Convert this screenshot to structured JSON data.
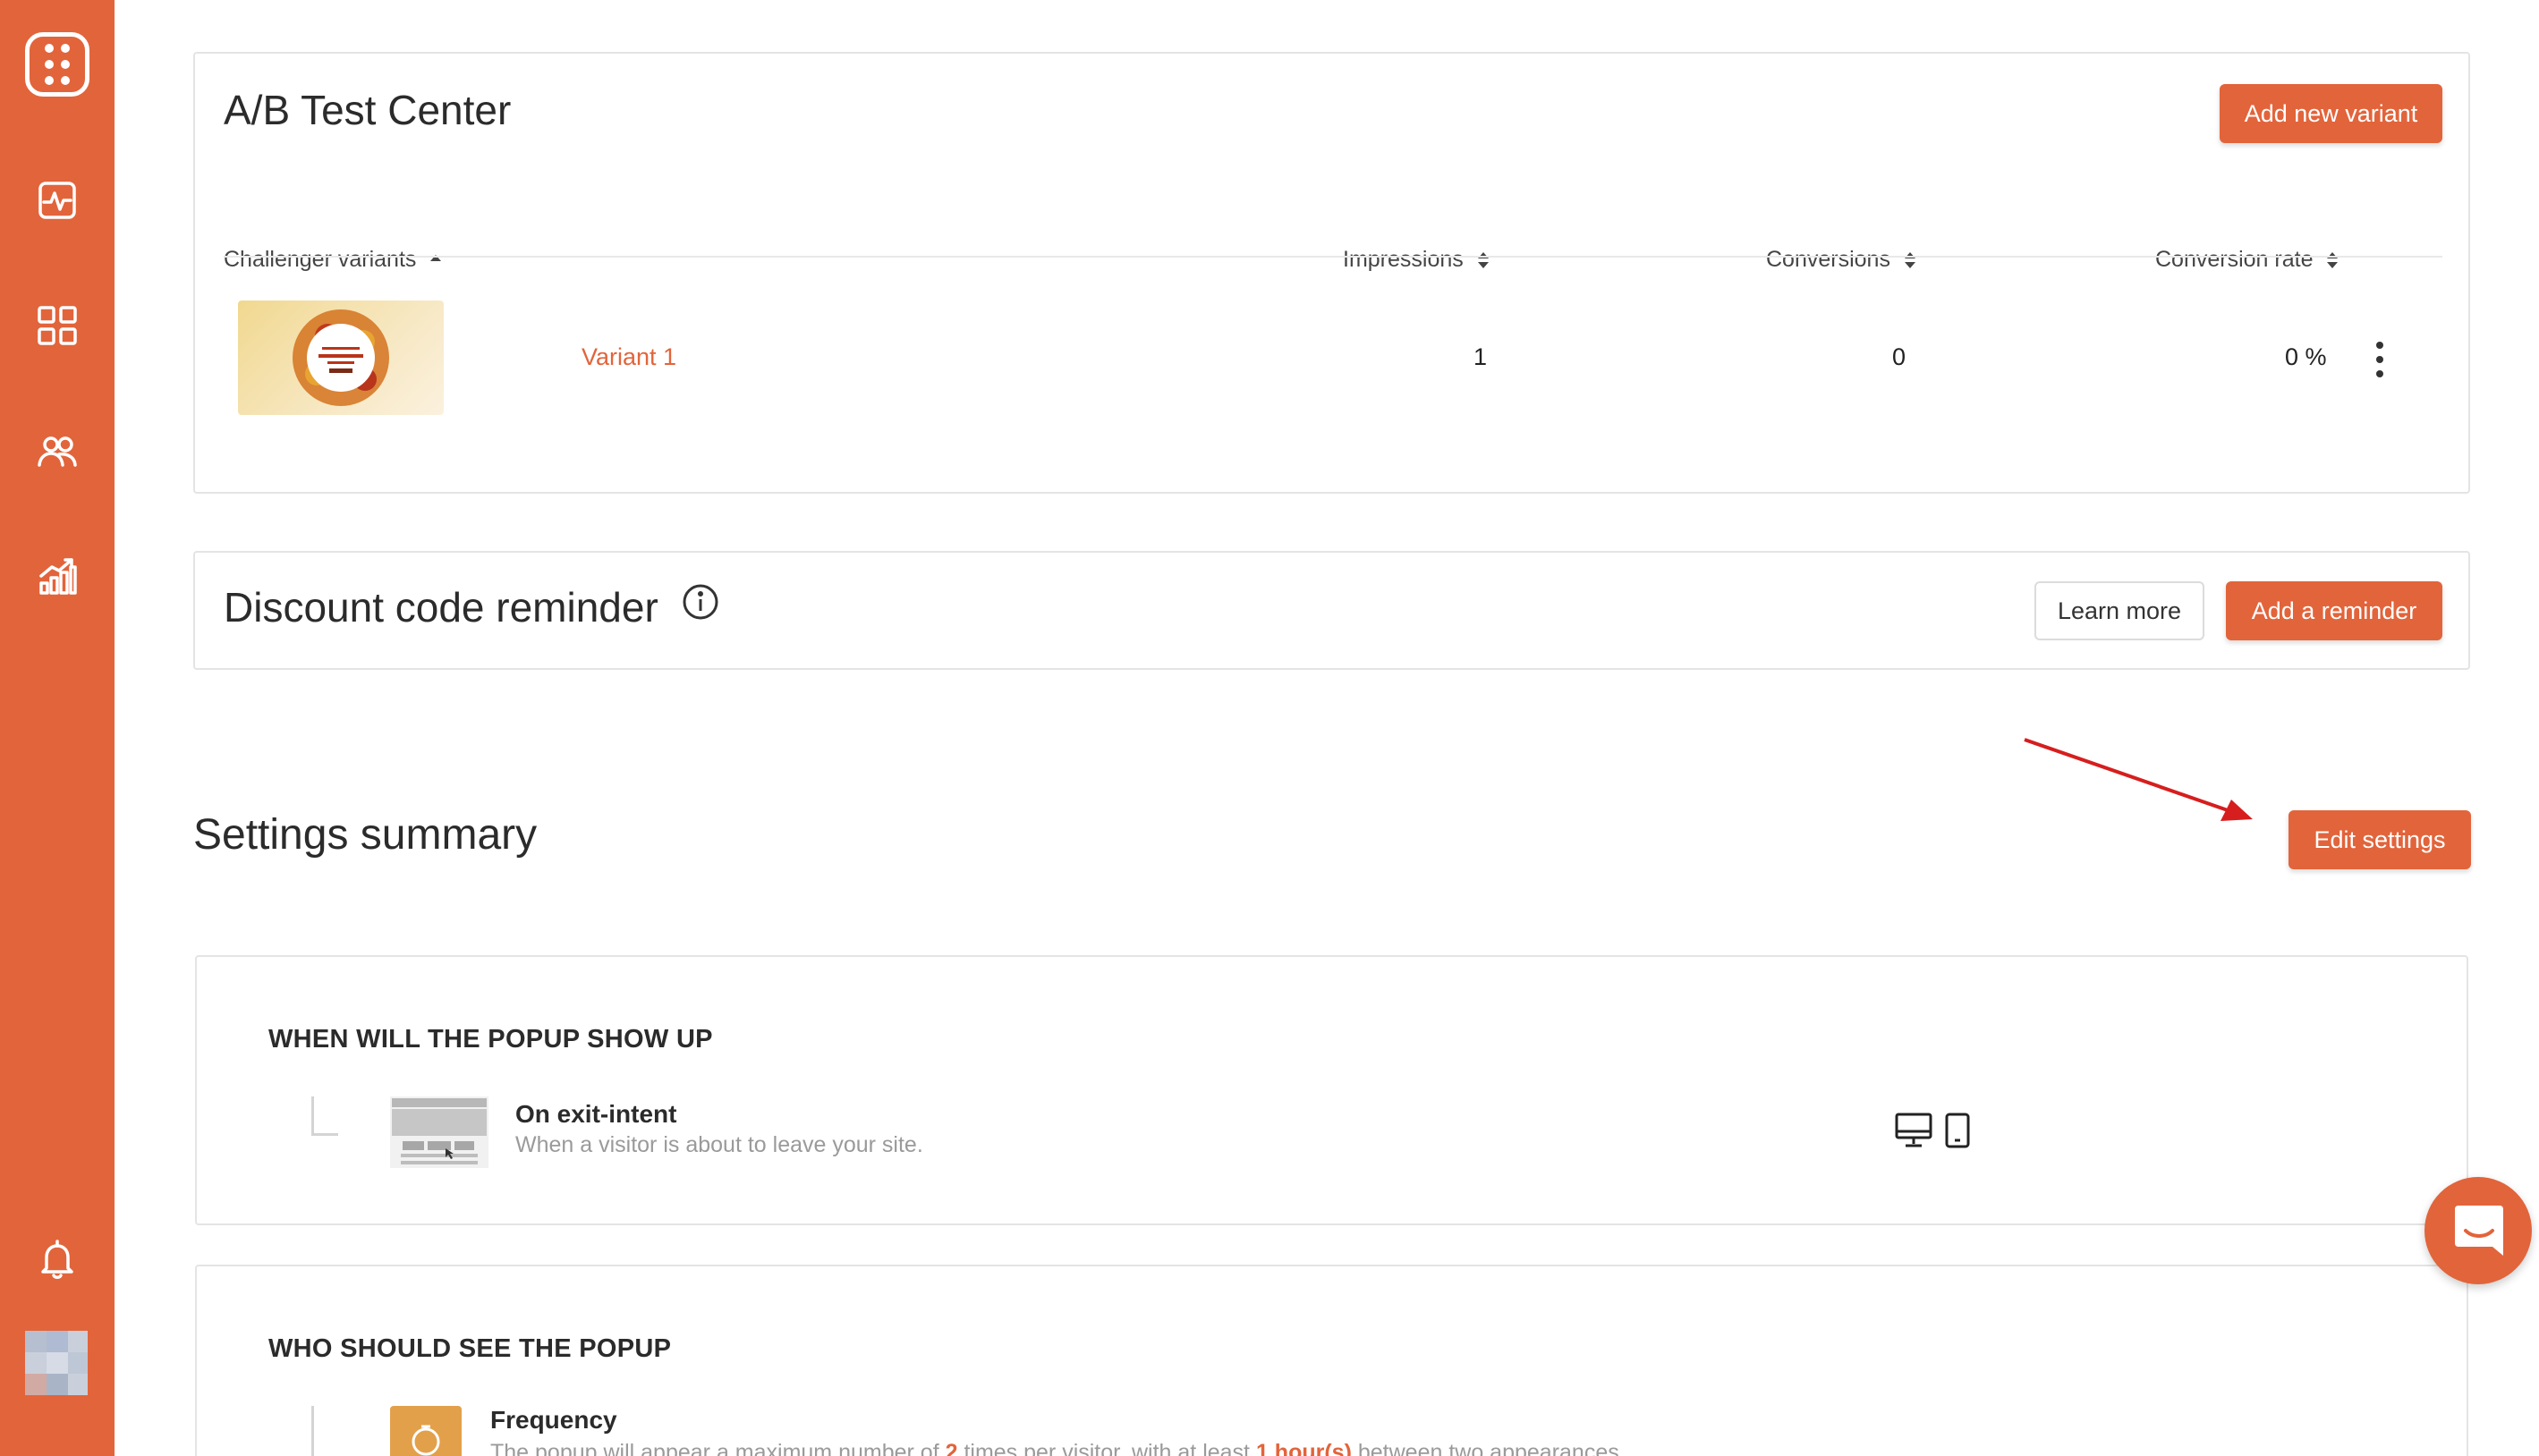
{
  "sidebar": {
    "items": [
      {
        "name": "dashboard"
      },
      {
        "name": "campaigns"
      },
      {
        "name": "audience"
      },
      {
        "name": "analytics"
      }
    ]
  },
  "ab_test": {
    "title": "A/B Test Center",
    "add_button": "Add new variant",
    "columns": [
      "Challenger variants",
      "Impressions",
      "Conversions",
      "Conversion rate"
    ],
    "rows": [
      {
        "variant": "Variant 1",
        "impressions": "1",
        "conversions": "0",
        "conversion_rate": "0 %"
      }
    ]
  },
  "discount": {
    "title": "Discount code reminder",
    "learn_more": "Learn more",
    "add_button": "Add a reminder"
  },
  "settings": {
    "title": "Settings summary",
    "edit_button": "Edit settings"
  },
  "when_section": {
    "heading": "WHEN WILL THE POPUP SHOW UP",
    "rule_title": "On exit-intent",
    "rule_desc": "When a visitor is about to leave your site."
  },
  "who_section": {
    "heading": "WHO SHOULD SEE THE POPUP",
    "rule_title": "Frequency",
    "desc_pre": "The popup will appear a maximum number of ",
    "desc_times": "2",
    "desc_mid": " times per visitor, with at least ",
    "desc_interval": "1 hour(s)",
    "desc_post": " between two appearances."
  },
  "colors": {
    "accent": "#e2643b",
    "annotation_arrow": "#d61e1e"
  }
}
